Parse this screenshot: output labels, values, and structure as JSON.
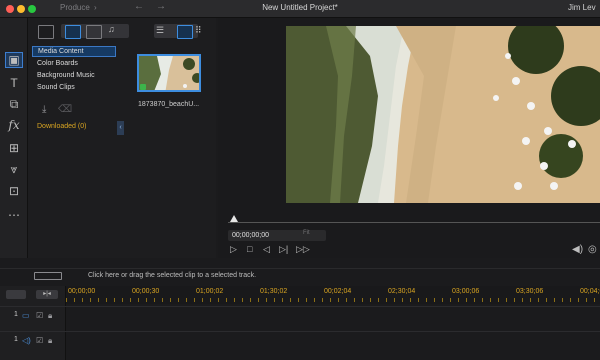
{
  "titlebar": {
    "left_text": "Produce",
    "title": "New Untitled Project*",
    "user": "Jim Lev"
  },
  "colors": {
    "accent": "#3d8ddf",
    "highlight": "#d9a522",
    "close": "#ff5f57",
    "minimize": "#febc2e",
    "zoom": "#28c840"
  },
  "tools": [
    {
      "name": "media-room-icon",
      "glyph": "▣"
    },
    {
      "name": "title-icon",
      "glyph": "T"
    },
    {
      "name": "transition-icon",
      "glyph": "⧉"
    },
    {
      "name": "fx-icon",
      "glyph": "fx"
    },
    {
      "name": "pip-icon",
      "glyph": "⊞"
    },
    {
      "name": "particle-icon",
      "glyph": "⩔"
    },
    {
      "name": "subtitle-icon",
      "glyph": "⊡"
    },
    {
      "name": "more-icon",
      "glyph": "⋯"
    }
  ],
  "library": {
    "categories": [
      "Media Content",
      "Color Boards",
      "Background Music",
      "Sound Clips"
    ],
    "downloaded": "Downloaded (0)",
    "clip_label": "1873870_beachU..."
  },
  "preview": {
    "timecode": "00;00;00;00",
    "fit": "Fit",
    "buttons": [
      "▷",
      "□",
      "◁",
      "▷|",
      "▷▷"
    ]
  },
  "timeline": {
    "hint": "Click here or drag the selected clip to a selected track.",
    "ticks": [
      "00;00;00",
      "00;00;30",
      "01;00;02",
      "01;30;02",
      "00;02;04",
      "02;30;04",
      "03;00;06",
      "03;30;06",
      "00;04;0"
    ],
    "tracks": [
      {
        "label": "1"
      },
      {
        "label": "1"
      }
    ]
  }
}
